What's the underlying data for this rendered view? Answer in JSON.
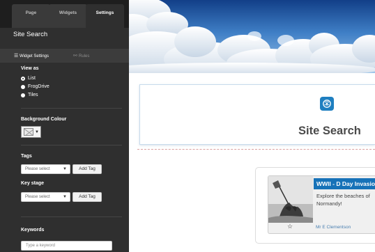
{
  "sidebar": {
    "tabs": [
      {
        "label": "Page"
      },
      {
        "label": "Widgets"
      },
      {
        "label": "Settings"
      }
    ],
    "title": "Site Search",
    "subtabs": [
      {
        "label": "Widget Settings",
        "icon": "sliders-icon"
      },
      {
        "label": "Rules",
        "icon": "rules-icon"
      }
    ],
    "view_as": {
      "label": "View as",
      "options": [
        "List",
        "FrogDrive",
        "Tiles"
      ],
      "selected": "List"
    },
    "background_colour": {
      "label": "Background Colour"
    },
    "tags": {
      "label": "Tags",
      "select_value": "Please select",
      "button_label": "Add Tag"
    },
    "key_stage": {
      "label": "Key stage",
      "select_value": "Please select",
      "button_label": "Add Tag"
    },
    "keywords": {
      "label": "Keywords",
      "placeholder": "Type a keyword"
    }
  },
  "main": {
    "widget": {
      "heading": "Site Search",
      "icon": "search-icon"
    },
    "result": {
      "title": "WWII - D Day Invasion",
      "description": "Explore the beaches of Normandy!",
      "author": "Mr E Clementson",
      "favourite_icon": "star-icon"
    }
  },
  "colors": {
    "sidebar_bg": "#2f2f2f",
    "accent_blue": "#1672b8",
    "heading_text": "#4a4a4a"
  }
}
